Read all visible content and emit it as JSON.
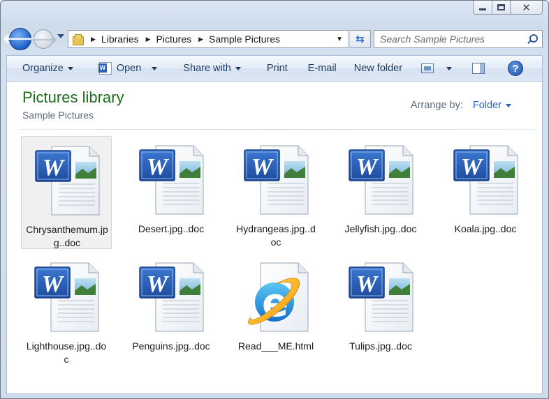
{
  "window": {
    "caption": {
      "minimize": "",
      "maximize": "",
      "close": "✕"
    }
  },
  "nav": {
    "back": "🡐",
    "forward": "🡒",
    "breadcrumb": [
      "Libraries",
      "Pictures",
      "Sample Pictures"
    ],
    "search_placeholder": "Search Sample Pictures"
  },
  "toolbar": {
    "organize": "Organize",
    "open": "Open",
    "share_with": "Share with",
    "print": "Print",
    "email": "E-mail",
    "new_folder": "New folder",
    "help": "?"
  },
  "library": {
    "title": "Pictures library",
    "subtitle": "Sample Pictures",
    "arrange_label": "Arrange by:",
    "arrange_value": "Folder"
  },
  "files": [
    {
      "name": "Chrysanthemum.jpg..doc",
      "type": "word-doc-icon",
      "selected": true
    },
    {
      "name": "Desert.jpg..doc",
      "type": "word-doc-icon",
      "selected": false
    },
    {
      "name": "Hydrangeas.jpg..doc",
      "type": "word-doc-icon",
      "selected": false
    },
    {
      "name": "Jellyfish.jpg..doc",
      "type": "word-doc-icon",
      "selected": false
    },
    {
      "name": "Koala.jpg..doc",
      "type": "word-doc-icon",
      "selected": false
    },
    {
      "name": "Lighthouse.jpg..doc",
      "type": "word-doc-icon",
      "selected": false
    },
    {
      "name": "Penguins.jpg..doc",
      "type": "word-doc-icon",
      "selected": false
    },
    {
      "name": "Read___ME.html",
      "type": "ie-html-icon",
      "selected": false
    },
    {
      "name": "Tulips.jpg..doc",
      "type": "word-doc-icon",
      "selected": false
    }
  ],
  "colors": {
    "library_title": "#1b6e19",
    "link_blue": "#2461c0",
    "word_blue": "#2a5fb3"
  }
}
